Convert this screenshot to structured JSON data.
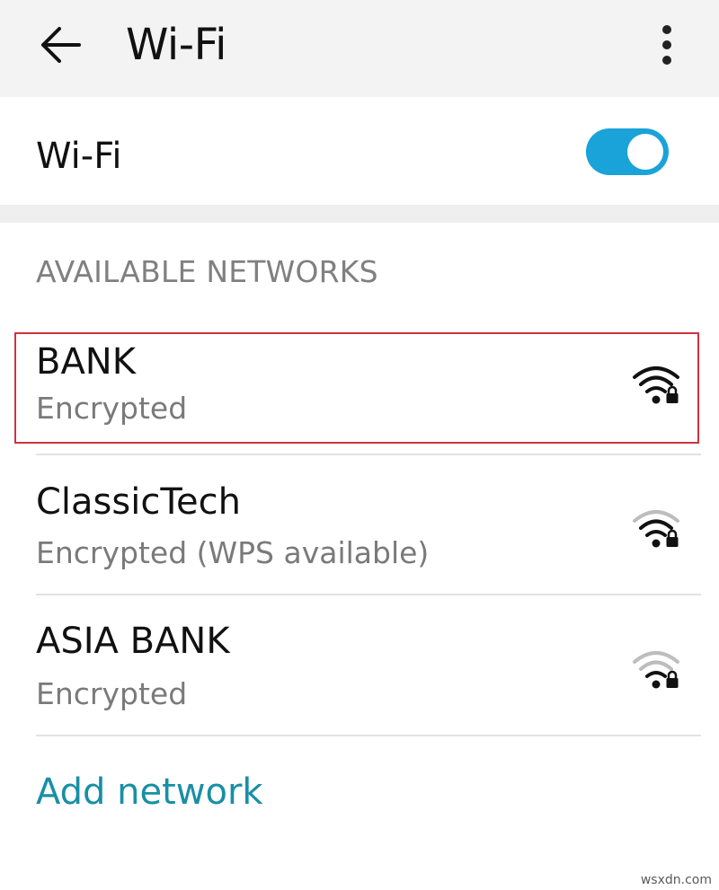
{
  "appbar": {
    "title": "Wi-Fi",
    "back_icon": "arrow-left-icon",
    "menu_icon": "more-vert-icon"
  },
  "wifi_toggle": {
    "label": "Wi-Fi",
    "state": "on",
    "accent_color": "#1aa3d8"
  },
  "available_networks": {
    "header": "AVAILABLE NETWORKS",
    "items": [
      {
        "name": "BANK",
        "status": "Encrypted",
        "signal_level": 4,
        "icon": "wifi-lock-icon",
        "highlighted": true
      },
      {
        "name": "ClassicTech",
        "status": "Encrypted (WPS available)",
        "signal_level": 3,
        "icon": "wifi-lock-icon",
        "highlighted": false
      },
      {
        "name": "ASIA BANK",
        "status": "Encrypted",
        "signal_level": 2,
        "icon": "wifi-lock-icon",
        "highlighted": false
      }
    ]
  },
  "add_network": {
    "label": "Add network",
    "color": "#188fa5"
  },
  "watermark": "wsxdn.com",
  "colors": {
    "highlight_border": "#cc3340",
    "appbar_bg": "#f3f3f3"
  }
}
